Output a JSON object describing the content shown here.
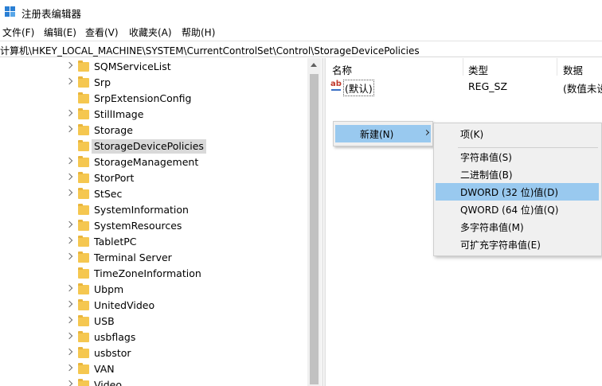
{
  "window": {
    "title": "注册表编辑器"
  },
  "menu": [
    "文件(F)",
    "编辑(E)",
    "查看(V)",
    "收藏夹(A)",
    "帮助(H)"
  ],
  "address": "计算机\\HKEY_LOCAL_MACHINE\\SYSTEM\\CurrentControlSet\\Control\\StorageDevicePolicies",
  "tree": {
    "items": [
      "SQMServiceList",
      "Srp",
      "SrpExtensionConfig",
      "StillImage",
      "Storage",
      "StorageDevicePolicies",
      "StorageManagement",
      "StorPort",
      "StSec",
      "SystemInformation",
      "SystemResources",
      "TabletPC",
      "Terminal Server",
      "TimeZoneInformation",
      "Ubpm",
      "UnitedVideo",
      "USB",
      "usbflags",
      "usbstor",
      "VAN",
      "Video"
    ],
    "selected": "StorageDevicePolicies"
  },
  "list": {
    "columns": [
      "名称",
      "类型",
      "数据"
    ],
    "rows": [
      {
        "name": "(默认)",
        "type": "REG_SZ",
        "data": "(数值未设"
      }
    ]
  },
  "context_menu": {
    "new_label": "新建(N)",
    "submenu": [
      "项(K)",
      "字符串值(S)",
      "二进制值(B)",
      "DWORD (32 位)值(D)",
      "QWORD (64 位)值(Q)",
      "多字符串值(M)",
      "可扩充字符串值(E)"
    ],
    "highlighted": "DWORD (32 位)值(D)"
  },
  "colors": {
    "selection": "#99c9ef",
    "tree_selected": "#d9d9d9",
    "folder": "#f5c750"
  },
  "icons": [
    "registry-editor-icon",
    "chevron-right-icon",
    "folder-icon",
    "string-value-icon",
    "scroll-up-icon",
    "submenu-arrow-icon"
  ]
}
